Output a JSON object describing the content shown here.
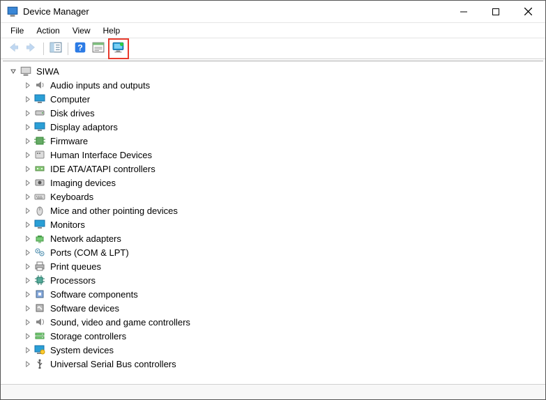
{
  "window": {
    "title": "Device Manager"
  },
  "menu": {
    "items": [
      "File",
      "Action",
      "View",
      "Help"
    ]
  },
  "toolbar": {
    "back": {
      "name": "back-button",
      "icon": "arrow-left-icon",
      "disabled": true
    },
    "forward": {
      "name": "forward-button",
      "icon": "arrow-right-icon",
      "disabled": true
    },
    "show_hide": {
      "name": "show-hide-console-tree-button",
      "icon": "tree-pane-icon"
    },
    "help": {
      "name": "help-button",
      "icon": "help-icon"
    },
    "properties": {
      "name": "properties-button",
      "icon": "properties-icon"
    },
    "scan": {
      "name": "scan-hardware-button",
      "icon": "scan-monitor-icon",
      "highlighted": true
    }
  },
  "tree": {
    "root": {
      "label": "SIWA",
      "icon": "computer-root-icon",
      "expanded": true
    },
    "children": [
      {
        "label": "Audio inputs and outputs",
        "icon": "audio-icon"
      },
      {
        "label": "Computer",
        "icon": "monitor-icon"
      },
      {
        "label": "Disk drives",
        "icon": "disk-icon"
      },
      {
        "label": "Display adaptors",
        "icon": "display-icon"
      },
      {
        "label": "Firmware",
        "icon": "firmware-icon"
      },
      {
        "label": "Human Interface Devices",
        "icon": "hid-icon"
      },
      {
        "label": "IDE ATA/ATAPI controllers",
        "icon": "ide-icon"
      },
      {
        "label": "Imaging devices",
        "icon": "imaging-icon"
      },
      {
        "label": "Keyboards",
        "icon": "keyboard-icon"
      },
      {
        "label": "Mice and other pointing devices",
        "icon": "mouse-icon"
      },
      {
        "label": "Monitors",
        "icon": "monitor-icon"
      },
      {
        "label": "Network adapters",
        "icon": "network-icon"
      },
      {
        "label": "Ports (COM & LPT)",
        "icon": "ports-icon"
      },
      {
        "label": "Print queues",
        "icon": "printer-icon"
      },
      {
        "label": "Processors",
        "icon": "cpu-icon"
      },
      {
        "label": "Software components",
        "icon": "software-comp-icon"
      },
      {
        "label": "Software devices",
        "icon": "software-dev-icon"
      },
      {
        "label": "Sound, video and game controllers",
        "icon": "sound-icon"
      },
      {
        "label": "Storage controllers",
        "icon": "storage-icon"
      },
      {
        "label": "System devices",
        "icon": "system-icon"
      },
      {
        "label": "Universal Serial Bus controllers",
        "icon": "usb-icon"
      }
    ]
  }
}
